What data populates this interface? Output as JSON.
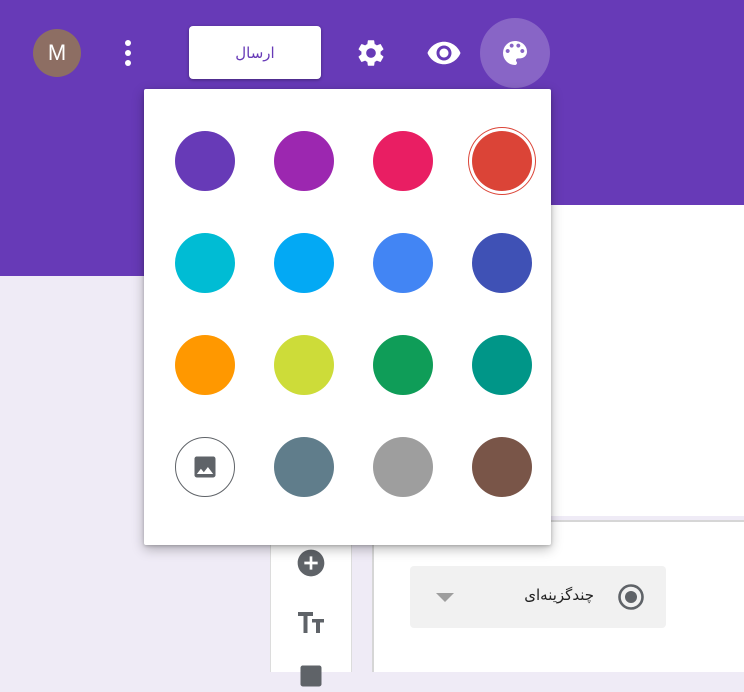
{
  "header": {
    "avatar_letter": "M",
    "send_label": "ارسال",
    "background": "#673ab7",
    "icons": [
      "more-vert-icon",
      "gear-icon",
      "eye-icon",
      "palette-icon"
    ]
  },
  "palette": {
    "selected": "#db4437",
    "swatches": [
      "#673ab7",
      "#9c27b0",
      "#e91e63",
      "#db4437",
      "#00bcd4",
      "#03a9f4",
      "#4285f4",
      "#3f51b5",
      "#ff9800",
      "#cddc39",
      "#0f9d58",
      "#009688",
      "image",
      "#607d8b",
      "#9e9e9e",
      "#795548"
    ],
    "image_icon": "image-icon"
  },
  "question": {
    "type_label": "چندگزینه‌ای",
    "type_icon": "radio-checked-icon",
    "dropdown_icon": "triangle-down-icon"
  },
  "toolbar": {
    "icons": [
      "add-circle-icon",
      "title-text-icon",
      "image-icon"
    ]
  }
}
